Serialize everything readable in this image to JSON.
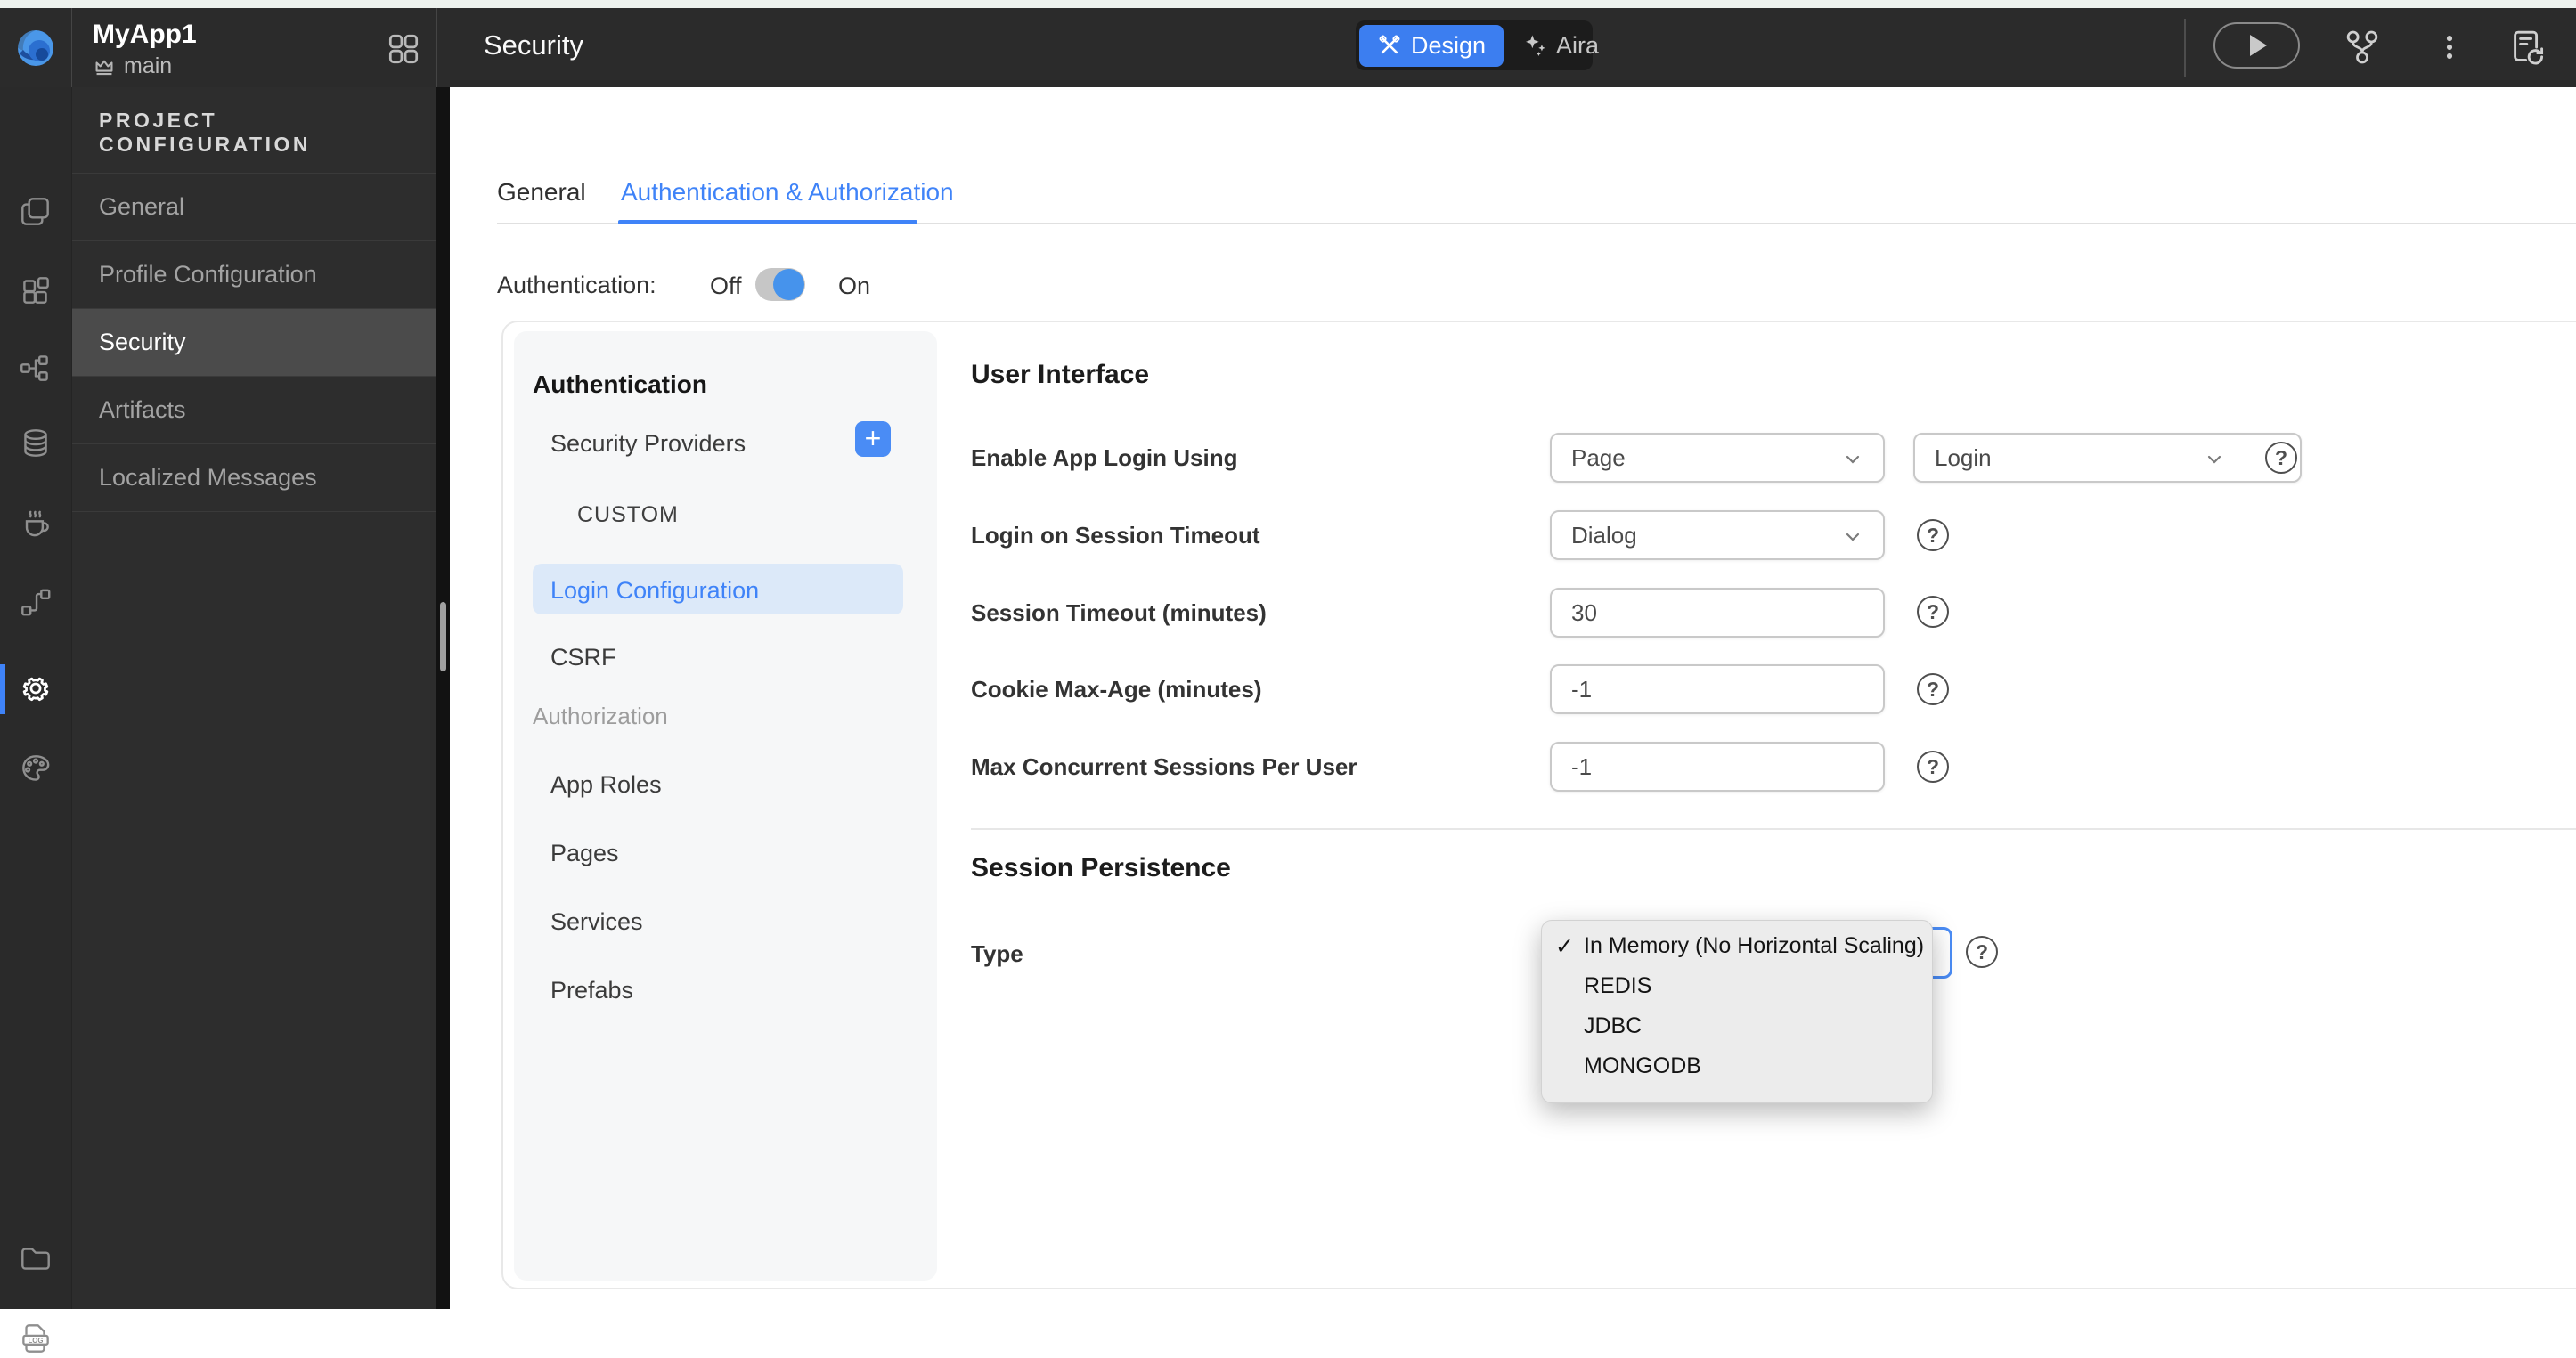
{
  "topbar": {
    "app_name": "MyApp1",
    "branch_name": "main",
    "page_title": "Security",
    "modes": {
      "design": "Design",
      "aira": "Aira"
    }
  },
  "project_panel": {
    "header": "PROJECT CONFIGURATION",
    "items": [
      {
        "label": "General",
        "selected": false
      },
      {
        "label": "Profile Configuration",
        "selected": false
      },
      {
        "label": "Security",
        "selected": true
      },
      {
        "label": "Artifacts",
        "selected": false
      },
      {
        "label": "Localized Messages",
        "selected": false
      }
    ]
  },
  "tabs": {
    "general": "General",
    "auth": "Authentication & Authorization"
  },
  "auth_row": {
    "label": "Authentication:",
    "off": "Off",
    "on": "On",
    "state": "on"
  },
  "nav": {
    "heading_authentication": "Authentication",
    "security_providers": "Security Providers",
    "custom_group": "CUSTOM",
    "login_configuration": "Login Configuration",
    "csrf": "CSRF",
    "heading_authorization": "Authorization",
    "app_roles": "App Roles",
    "pages": "Pages",
    "services": "Services",
    "prefabs": "Prefabs",
    "selected_item": "Login Configuration"
  },
  "form": {
    "heading_user_interface": "User Interface",
    "enable_app_login": {
      "label": "Enable App Login Using",
      "value1": "Page",
      "value2": "Login"
    },
    "login_on_session_timeout": {
      "label": "Login on Session Timeout",
      "value": "Dialog"
    },
    "session_timeout": {
      "label": "Session Timeout (minutes)",
      "value": "30"
    },
    "cookie_max_age": {
      "label": "Cookie Max-Age (minutes)",
      "value": "-1"
    },
    "max_concurrent_sessions": {
      "label": "Max Concurrent Sessions Per User",
      "value": "-1"
    },
    "heading_session_persistence": "Session Persistence",
    "type_label": "Type"
  },
  "type_menu": {
    "items": [
      {
        "label": "In Memory (No Horizontal Scaling)",
        "checked": true
      },
      {
        "label": "REDIS",
        "checked": false
      },
      {
        "label": "JDBC",
        "checked": false
      },
      {
        "label": "MONGODB",
        "checked": false
      }
    ]
  },
  "icons": {
    "question": "?",
    "plus": "+",
    "check": "✓",
    "log_text": "LOG"
  },
  "colors": {
    "topbar_bg": "#2b2b2b",
    "accent_blue": "#3f83f8",
    "design_button_blue": "#3c7ef0",
    "selected_nav_bg": "#dce9f9",
    "toggle_knob_blue": "#4693ec",
    "selected_project_item_bg": "#4b4b4b",
    "menu_bg": "#ececec"
  }
}
